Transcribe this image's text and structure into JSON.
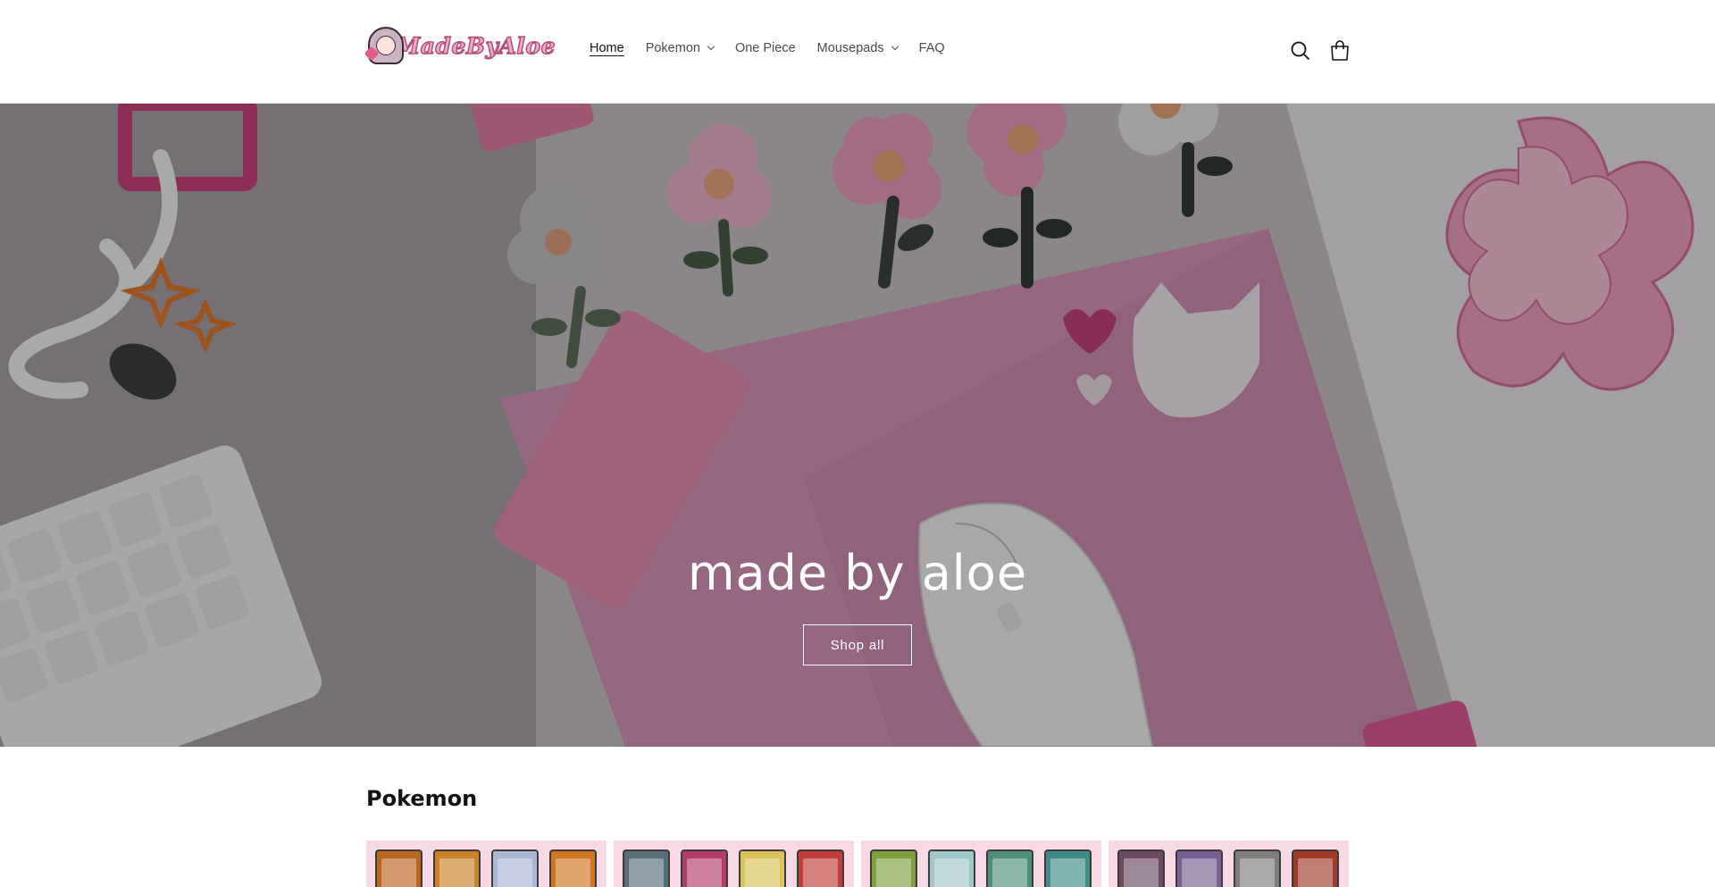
{
  "brand": {
    "logo_text": "MadeByAloe"
  },
  "nav": {
    "items": [
      {
        "label": "Home",
        "active": true,
        "has_dropdown": false
      },
      {
        "label": "Pokemon",
        "active": false,
        "has_dropdown": true
      },
      {
        "label": "One Piece",
        "active": false,
        "has_dropdown": false
      },
      {
        "label": "Mousepads",
        "active": false,
        "has_dropdown": true
      },
      {
        "label": "FAQ",
        "active": false,
        "has_dropdown": false
      }
    ]
  },
  "header_icons": {
    "search": "search-icon",
    "cart": "cart-icon"
  },
  "hero": {
    "title": "made by aloe",
    "button_label": "Shop all"
  },
  "collection": {
    "title": "Pokemon",
    "cards": [
      {
        "colors": [
          "#b8651f",
          "#c9822a",
          "#a9b7cf",
          "#d0761f"
        ]
      },
      {
        "colors": [
          "#556e7a",
          "#b23b6c",
          "#d9c35a",
          "#c23c3c"
        ]
      },
      {
        "colors": [
          "#7fa03c",
          "#9fc6c9",
          "#4f8f79",
          "#3f8a8a"
        ]
      },
      {
        "colors": [
          "#6b4a63",
          "#7a5f94",
          "#7d7f7a",
          "#a23a2a"
        ]
      }
    ]
  },
  "colors": {
    "accent_pink": "#f9d9e6",
    "text": "#121212"
  }
}
